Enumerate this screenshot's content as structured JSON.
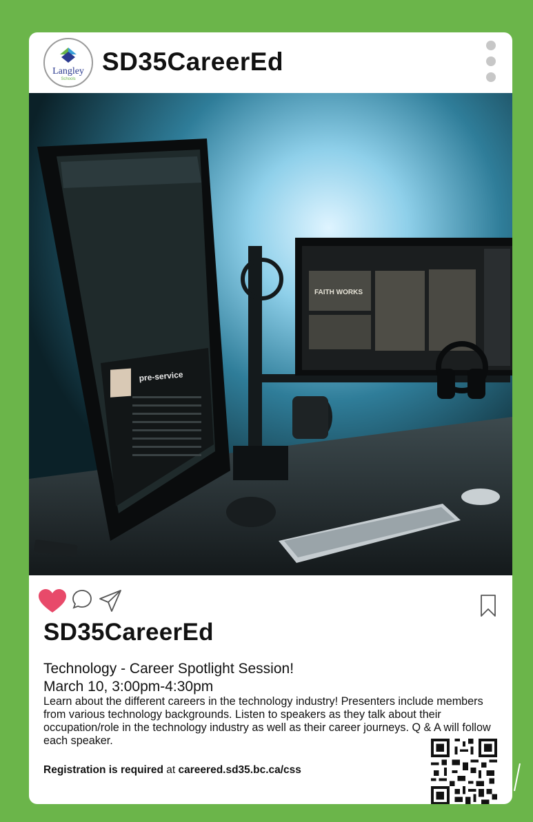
{
  "post": {
    "handle": "SD35CareerEd",
    "logo_text": "Langley",
    "logo_subtext": "Schools"
  },
  "caption": {
    "account_name": "SD35CareerEd",
    "event_title": "Technology - Career Spotlight Session!",
    "event_date": "March 10, 3:00pm-4:30pm",
    "description": "Learn about the different careers in the technology industry!  Presenters include members from various technology backgrounds.  Listen to speakers as they talk about their occupation/role in the technology industry as well as their career journeys.  Q & A will follow each speaker.",
    "registration_bold": "Registration is required",
    "registration_at": " at ",
    "registration_url": "careered.sd35.bc.ca/css"
  },
  "photo_text": {
    "screen_song": "pre-service",
    "monitor_text": "FAITH WORKS"
  },
  "colors": {
    "frame_green": "#6bb54a",
    "heart_pink": "#e84a6a",
    "card_white": "#ffffff"
  },
  "icons": [
    "kebab-menu-icon",
    "heart-icon",
    "comment-icon",
    "share-icon",
    "bookmark-icon",
    "qr-code"
  ]
}
